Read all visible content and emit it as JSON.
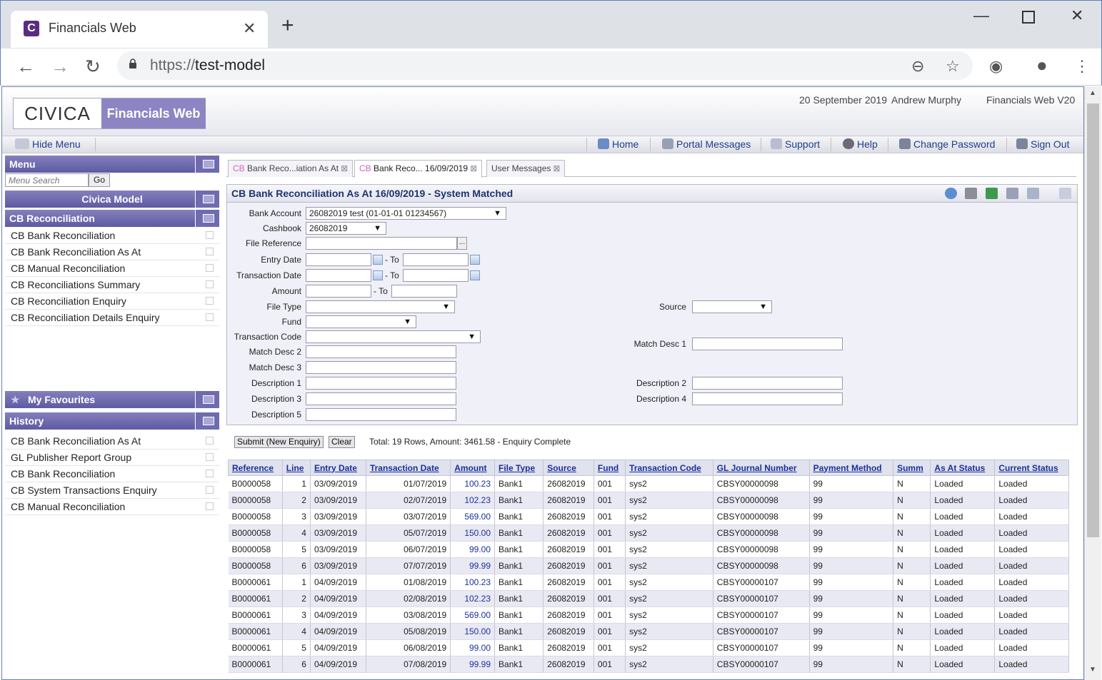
{
  "browser": {
    "tab_title": "Financials Web",
    "tab_favicon": "C",
    "url_scheme": "https://",
    "url_host": "test-model"
  },
  "header": {
    "logo_left": "CIVICA",
    "logo_right": "Financials Web",
    "date": "20 September 2019",
    "user": "Andrew Murphy",
    "version": "Financials Web V20"
  },
  "navbar": {
    "hide_menu": "Hide Menu",
    "home": "Home",
    "portal_messages": "Portal Messages",
    "support": "Support",
    "help": "Help",
    "change_password": "Change Password",
    "sign_out": "Sign Out"
  },
  "sidebar": {
    "menu_title": "Menu",
    "search_placeholder": "Menu Search",
    "go": "Go",
    "model_title": "Civica Model",
    "section_title": "CB Reconciliation",
    "items": [
      {
        "label": "CB Bank Reconciliation"
      },
      {
        "label": "CB Bank Reconciliation As At"
      },
      {
        "label": "CB Manual Reconciliation"
      },
      {
        "label": "CB Reconciliations Summary"
      },
      {
        "label": "CB Reconciliation Enquiry"
      },
      {
        "label": "CB Reconciliation Details Enquiry"
      }
    ],
    "favourites_title": "My Favourites",
    "history_title": "History",
    "history": [
      {
        "label": "CB Bank Reconciliation As At"
      },
      {
        "label": "GL Publisher Report Group"
      },
      {
        "label": "CB Bank Reconciliation"
      },
      {
        "label": "CB System Transactions Enquiry"
      },
      {
        "label": "CB Manual Reconciliation"
      }
    ]
  },
  "tabs": [
    {
      "prefix": "CB",
      "label": "Bank Reco...iation As At"
    },
    {
      "prefix": "CB",
      "label": "Bank Reco... 16/09/2019"
    },
    {
      "prefix": "",
      "label": "User Messages"
    }
  ],
  "panel": {
    "title": "CB Bank Reconciliation As At 16/09/2019 - System Matched"
  },
  "form": {
    "bank_account_label": "Bank Account",
    "bank_account_value": "26082019 test (01-01-01 01234567)",
    "cashbook_label": "Cashbook",
    "cashbook_value": "26082019",
    "file_reference_label": "File Reference",
    "entry_date_label": "Entry Date",
    "transaction_date_label": "Transaction Date",
    "amount_label": "Amount",
    "to_label": "- To",
    "file_type_label": "File Type",
    "source_label": "Source",
    "fund_label": "Fund",
    "transaction_code_label": "Transaction Code",
    "match_desc1_label": "Match Desc 1",
    "match_desc2_label": "Match Desc 2",
    "match_desc3_label": "Match Desc 3",
    "description1_label": "Description 1",
    "description2_label": "Description 2",
    "description3_label": "Description 3",
    "description4_label": "Description 4",
    "description5_label": "Description 5",
    "browse": "..."
  },
  "actions": {
    "submit": "Submit (New Enquiry)",
    "clear": "Clear",
    "status": "Total: 19 Rows, Amount: 3461.58 - Enquiry Complete"
  },
  "grid": {
    "columns": [
      "Reference",
      "Line",
      "Entry Date",
      "Transaction Date",
      "Amount",
      "File Type",
      "Source",
      "Fund",
      "Transaction Code",
      "GL Journal Number",
      "Payment Method",
      "Summ",
      "As At Status",
      "Current Status"
    ],
    "rows": [
      [
        "B0000058",
        "1",
        "03/09/2019",
        "01/07/2019",
        "100.23",
        "Bank1",
        "26082019",
        "001",
        "sys2",
        "CBSY00000098",
        "99",
        "N",
        "Loaded",
        "Loaded"
      ],
      [
        "B0000058",
        "2",
        "03/09/2019",
        "02/07/2019",
        "102.23",
        "Bank1",
        "26082019",
        "001",
        "sys2",
        "CBSY00000098",
        "99",
        "N",
        "Loaded",
        "Loaded"
      ],
      [
        "B0000058",
        "3",
        "03/09/2019",
        "03/07/2019",
        "569.00",
        "Bank1",
        "26082019",
        "001",
        "sys2",
        "CBSY00000098",
        "99",
        "N",
        "Loaded",
        "Loaded"
      ],
      [
        "B0000058",
        "4",
        "03/09/2019",
        "05/07/2019",
        "150.00",
        "Bank1",
        "26082019",
        "001",
        "sys2",
        "CBSY00000098",
        "99",
        "N",
        "Loaded",
        "Loaded"
      ],
      [
        "B0000058",
        "5",
        "03/09/2019",
        "06/07/2019",
        "99.00",
        "Bank1",
        "26082019",
        "001",
        "sys2",
        "CBSY00000098",
        "99",
        "N",
        "Loaded",
        "Loaded"
      ],
      [
        "B0000058",
        "6",
        "03/09/2019",
        "07/07/2019",
        "99.99",
        "Bank1",
        "26082019",
        "001",
        "sys2",
        "CBSY00000098",
        "99",
        "N",
        "Loaded",
        "Loaded"
      ],
      [
        "B0000061",
        "1",
        "04/09/2019",
        "01/08/2019",
        "100.23",
        "Bank1",
        "26082019",
        "001",
        "sys2",
        "CBSY00000107",
        "99",
        "N",
        "Loaded",
        "Loaded"
      ],
      [
        "B0000061",
        "2",
        "04/09/2019",
        "02/08/2019",
        "102.23",
        "Bank1",
        "26082019",
        "001",
        "sys2",
        "CBSY00000107",
        "99",
        "N",
        "Loaded",
        "Loaded"
      ],
      [
        "B0000061",
        "3",
        "04/09/2019",
        "03/08/2019",
        "569.00",
        "Bank1",
        "26082019",
        "001",
        "sys2",
        "CBSY00000107",
        "99",
        "N",
        "Loaded",
        "Loaded"
      ],
      [
        "B0000061",
        "4",
        "04/09/2019",
        "05/08/2019",
        "150.00",
        "Bank1",
        "26082019",
        "001",
        "sys2",
        "CBSY00000107",
        "99",
        "N",
        "Loaded",
        "Loaded"
      ],
      [
        "B0000061",
        "5",
        "04/09/2019",
        "06/08/2019",
        "99.00",
        "Bank1",
        "26082019",
        "001",
        "sys2",
        "CBSY00000107",
        "99",
        "N",
        "Loaded",
        "Loaded"
      ],
      [
        "B0000061",
        "6",
        "04/09/2019",
        "07/08/2019",
        "99.99",
        "Bank1",
        "26082019",
        "001",
        "sys2",
        "CBSY00000107",
        "99",
        "N",
        "Loaded",
        "Loaded"
      ]
    ]
  },
  "colors": {
    "sidebar_header": "#6a66ac",
    "link": "#1c3f8c",
    "alt_row": "#e9e9f4"
  }
}
